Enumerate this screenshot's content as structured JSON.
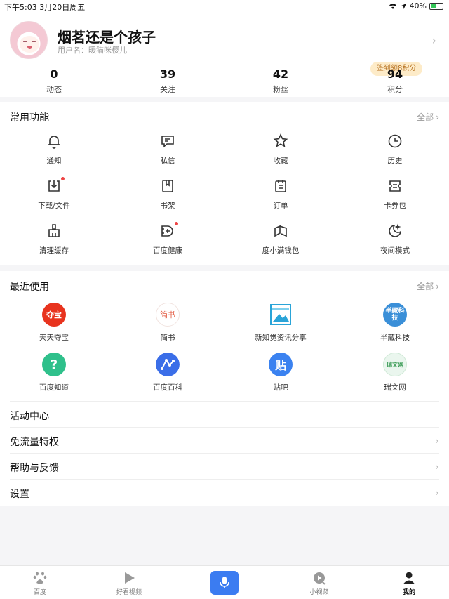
{
  "status": {
    "time": "下午5:03   3月20日周五",
    "battery": "40%"
  },
  "profile": {
    "nickname": "烟茗还是个孩子",
    "username": "用户名：暖猫咪樱儿",
    "signin_badge": "签到领8积分"
  },
  "stats": [
    {
      "value": "0",
      "label": "动态"
    },
    {
      "value": "39",
      "label": "关注"
    },
    {
      "value": "42",
      "label": "粉丝"
    },
    {
      "value": "94",
      "label": "积分"
    }
  ],
  "common": {
    "title": "常用功能",
    "more": "全部",
    "items": [
      {
        "label": "通知",
        "icon": "bell-icon"
      },
      {
        "label": "私信",
        "icon": "message-icon"
      },
      {
        "label": "收藏",
        "icon": "star-icon"
      },
      {
        "label": "历史",
        "icon": "clock-icon"
      },
      {
        "label": "下载/文件",
        "icon": "download-icon"
      },
      {
        "label": "书架",
        "icon": "bookmark-icon"
      },
      {
        "label": "订单",
        "icon": "order-icon"
      },
      {
        "label": "卡券包",
        "icon": "ticket-icon"
      },
      {
        "label": "清理缓存",
        "icon": "broom-icon"
      },
      {
        "label": "百度健康",
        "icon": "health-icon"
      },
      {
        "label": "度小满钱包",
        "icon": "wallet-icon"
      },
      {
        "label": "夜间模式",
        "icon": "moon-icon"
      }
    ]
  },
  "recent": {
    "title": "最近使用",
    "more": "全部",
    "apps": [
      {
        "label": "天天夺宝",
        "logo_text": "夺宝",
        "color": "#e8331e"
      },
      {
        "label": "简书",
        "logo_text": "简书",
        "color": "#ffffff"
      },
      {
        "label": "新知觉资讯分享",
        "logo_text": "",
        "color": "#2aa4d8"
      },
      {
        "label": "半藏科技",
        "logo_text": "半藏科技",
        "color": "#3a8fd8"
      },
      {
        "label": "百度知道",
        "logo_text": "?",
        "color": "#2fc08b"
      },
      {
        "label": "百度百科",
        "logo_text": "",
        "color": "#3b6ee8"
      },
      {
        "label": "贴吧",
        "logo_text": "贴",
        "color": "#3b82f0"
      },
      {
        "label": "瑞文网",
        "logo_text": "瑞文网",
        "color": "#4fb96a"
      }
    ]
  },
  "menu": [
    {
      "label": "活动中心",
      "arrow": false
    },
    {
      "label": "免流量特权",
      "arrow": true
    },
    {
      "label": "帮助与反馈",
      "arrow": true
    },
    {
      "label": "设置",
      "arrow": true
    }
  ],
  "tabs": [
    {
      "label": "百度",
      "icon": "baidu-paw-icon"
    },
    {
      "label": "好看视频",
      "icon": "play-icon"
    },
    {
      "label": "小视频",
      "icon": "mini-video-icon"
    },
    {
      "label": "我的",
      "icon": "person-icon"
    }
  ],
  "colors": {
    "accent": "#3b7cf1",
    "badge_bg": "#fdebc8",
    "badge_text": "#b36b17",
    "dot": "#ee4444"
  }
}
